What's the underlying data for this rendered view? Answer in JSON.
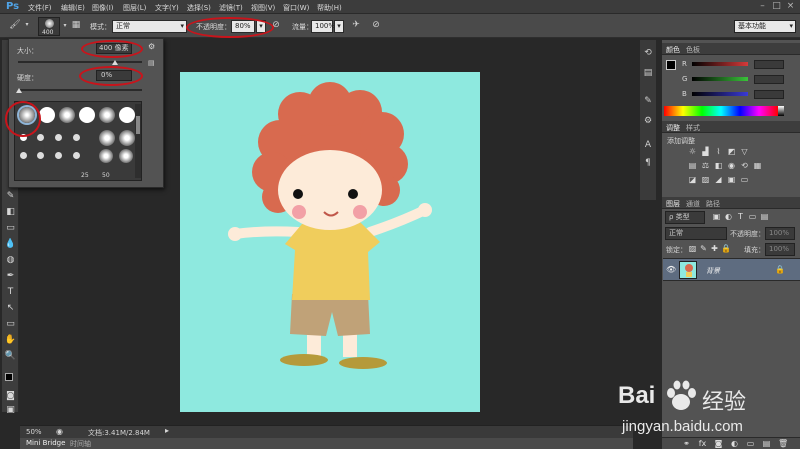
{
  "app": {
    "logo": "Ps"
  },
  "menu": [
    "文件(F)",
    "编辑(E)",
    "图像(I)",
    "图层(L)",
    "文字(Y)",
    "选择(S)",
    "滤镜(T)",
    "视图(V)",
    "窗口(W)",
    "帮助(H)"
  ],
  "window_controls": [
    "–",
    "□",
    "×"
  ],
  "options_bar": {
    "brush_size_badge": "400",
    "mode_label": "模式：",
    "mode_value": "正常",
    "opacity_label": "不透明度：",
    "opacity_value": "80%",
    "flow_label": "流量：",
    "flow_value": "100%",
    "workspace": "基本功能"
  },
  "brush_panel": {
    "size_label": "大小：",
    "size_value": "400 像素",
    "hardness_label": "硬度：",
    "hardness_value": "0%",
    "preset_nums": [
      "25",
      "50"
    ]
  },
  "status": {
    "zoom": "50%",
    "doc_info": "文档:3.41M/2.84M"
  },
  "bottom_tabs": {
    "bridge": "Mini Bridge",
    "timeline": "时间轴"
  },
  "color_panel": {
    "tabs": [
      "颜色",
      "色板"
    ],
    "channels": [
      {
        "name": "R",
        "color": "#d63a3a"
      },
      {
        "name": "G",
        "color": "#3ac43a"
      },
      {
        "name": "B",
        "color": "#3a3ad6"
      }
    ]
  },
  "adjust_panel": {
    "tabs": [
      "调整",
      "样式"
    ],
    "title": "添加调整"
  },
  "layers_panel": {
    "tabs": [
      "图层",
      "通道",
      "路径"
    ],
    "filter_label": "ρ 类型",
    "blend_mode": "正常",
    "opacity_label": "不透明度：",
    "opacity_value": "100%",
    "lock_label": "锁定：",
    "fill_label": "填充：",
    "fill_value": "100%",
    "layer_name": "背景"
  },
  "watermark": {
    "brand_left": "Bai",
    "brand_right": "经验",
    "url": "jingyan.baidu.com"
  },
  "colors": {
    "canvas": "#8ee9df",
    "hair": "#d86a4f",
    "shirt": "#f0cd5c",
    "shorts": "#c0a278",
    "skin": "#fdebd9",
    "annotation": "#c9141b"
  }
}
